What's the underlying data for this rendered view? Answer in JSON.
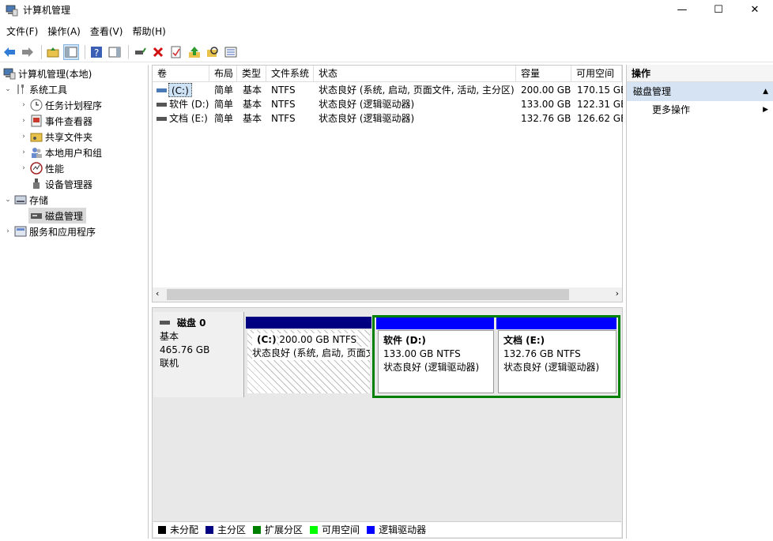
{
  "window": {
    "title": "计算机管理",
    "minimize": "—",
    "maximize": "☐",
    "close": "✕"
  },
  "menu": [
    "文件(F)",
    "操作(A)",
    "查看(V)",
    "帮助(H)"
  ],
  "tree": {
    "root": "计算机管理(本地)",
    "system_tools": "系统工具",
    "task_scheduler": "任务计划程序",
    "event_viewer": "事件查看器",
    "shared_folders": "共享文件夹",
    "local_users": "本地用户和组",
    "performance": "性能",
    "device_manager": "设备管理器",
    "storage": "存储",
    "disk_management": "磁盘管理",
    "services": "服务和应用程序"
  },
  "volumes": {
    "headers": [
      "卷",
      "布局",
      "类型",
      "文件系统",
      "状态",
      "容量",
      "可用空间"
    ],
    "rows": [
      [
        "(C:)",
        "简单",
        "基本",
        "NTFS",
        "状态良好 (系统, 启动, 页面文件, 活动, 主分区)",
        "200.00 GB",
        "170.15 GB"
      ],
      [
        "软件 (D:)",
        "简单",
        "基本",
        "NTFS",
        "状态良好 (逻辑驱动器)",
        "133.00 GB",
        "122.31 GB"
      ],
      [
        "文档 (E:)",
        "简单",
        "基本",
        "NTFS",
        "状态良好 (逻辑驱动器)",
        "132.76 GB",
        "126.62 GB"
      ]
    ]
  },
  "disk": {
    "name": "磁盘 0",
    "type": "基本",
    "size": "465.76 GB",
    "status": "联机",
    "partitions": [
      {
        "name": "(C:)",
        "size": "200.00 GB NTFS",
        "status": "状态良好 (系统, 启动, 页面文",
        "color": "#000080"
      },
      {
        "name": "软件  (D:)",
        "size": "133.00 GB NTFS",
        "status": "状态良好 (逻辑驱动器)",
        "color": "#0000ff"
      },
      {
        "name": "文档  (E:)",
        "size": "132.76 GB NTFS",
        "status": "状态良好 (逻辑驱动器)",
        "color": "#0000ff"
      }
    ],
    "extended_color": "#008000"
  },
  "legend": [
    {
      "label": "未分配",
      "color": "#000000"
    },
    {
      "label": "主分区",
      "color": "#000080"
    },
    {
      "label": "扩展分区",
      "color": "#008000"
    },
    {
      "label": "可用空间",
      "color": "#00ff00"
    },
    {
      "label": "逻辑驱动器",
      "color": "#0000ff"
    }
  ],
  "actions": {
    "header": "操作",
    "section": "磁盘管理",
    "more": "更多操作"
  }
}
